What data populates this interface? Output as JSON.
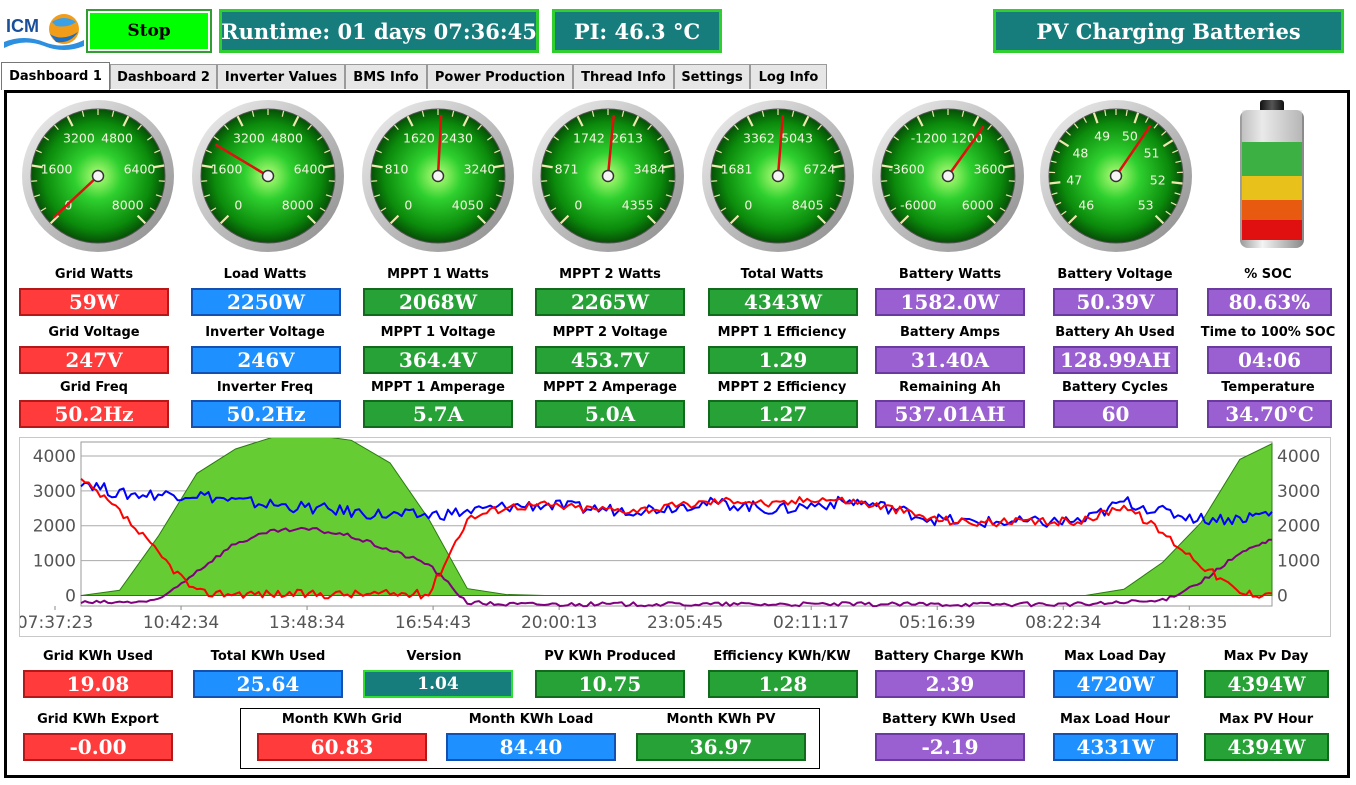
{
  "header": {
    "logo_text": "ICM",
    "stop_label": "Stop",
    "runtime": "Runtime: 01 days 07:36:45",
    "pi_temp": "PI: 46.3 °C",
    "status": "PV Charging Batteries"
  },
  "tabs": [
    {
      "label": "Dashboard 1",
      "active": true
    },
    {
      "label": "Dashboard 2"
    },
    {
      "label": "Inverter Values"
    },
    {
      "label": "BMS Info"
    },
    {
      "label": "Power Production"
    },
    {
      "label": "Thread Info"
    },
    {
      "label": "Settings"
    },
    {
      "label": "Log Info"
    }
  ],
  "gauges": [
    {
      "ticks": [
        "0",
        "1600",
        "3200",
        "4800",
        "6400",
        "8000"
      ],
      "needle_fraction": 0.007
    },
    {
      "ticks": [
        "0",
        "1600",
        "3200",
        "4800",
        "6400",
        "8000"
      ],
      "needle_fraction": 0.281
    },
    {
      "ticks": [
        "0",
        "810",
        "1620",
        "2430",
        "3240",
        "4050"
      ],
      "needle_fraction": 0.511
    },
    {
      "ticks": [
        "0",
        "871",
        "1742",
        "2613",
        "3484",
        "4355"
      ],
      "needle_fraction": 0.52
    },
    {
      "ticks": [
        "0",
        "1681",
        "3362",
        "5043",
        "6724",
        "8405"
      ],
      "needle_fraction": 0.517
    },
    {
      "ticks": [
        "-6000",
        "-3600",
        "-1200",
        "1200",
        "3600",
        "6000"
      ],
      "needle_fraction": 0.632
    },
    {
      "ticks": [
        "46",
        "47",
        "48",
        "49",
        "50",
        "51",
        "52",
        "53"
      ],
      "needle_fraction": 0.627
    }
  ],
  "battery_gauge": {
    "soc_percent": 80.63
  },
  "metrics": {
    "row1": [
      {
        "label": "Grid Watts",
        "value": "59W",
        "color": "red"
      },
      {
        "label": "Load Watts",
        "value": "2250W",
        "color": "blue"
      },
      {
        "label": "MPPT 1 Watts",
        "value": "2068W",
        "color": "green"
      },
      {
        "label": "MPPT 2 Watts",
        "value": "2265W",
        "color": "green"
      },
      {
        "label": "Total Watts",
        "value": "4343W",
        "color": "green"
      },
      {
        "label": "Battery Watts",
        "value": "1582.0W",
        "color": "purple"
      },
      {
        "label": "Battery Voltage",
        "value": "50.39V",
        "color": "purple"
      },
      {
        "label": "% SOC",
        "value": "80.63%",
        "color": "purple"
      }
    ],
    "row2": [
      {
        "label": "Grid Voltage",
        "value": "247V",
        "color": "red"
      },
      {
        "label": "Inverter Voltage",
        "value": "246V",
        "color": "blue"
      },
      {
        "label": "MPPT 1 Voltage",
        "value": "364.4V",
        "color": "green"
      },
      {
        "label": "MPPT 2 Voltage",
        "value": "453.7V",
        "color": "green"
      },
      {
        "label": "MPPT 1 Efficiency",
        "value": "1.29",
        "color": "green"
      },
      {
        "label": "Battery Amps",
        "value": "31.40A",
        "color": "purple"
      },
      {
        "label": "Battery Ah Used",
        "value": "128.99AH",
        "color": "purple"
      },
      {
        "label": "Time to 100% SOC",
        "value": "04:06",
        "color": "purple"
      }
    ],
    "row3": [
      {
        "label": "Grid Freq",
        "value": "50.2Hz",
        "color": "red"
      },
      {
        "label": "Inverter Freq",
        "value": "50.2Hz",
        "color": "blue"
      },
      {
        "label": "MPPT 1 Amperage",
        "value": "5.7A",
        "color": "green"
      },
      {
        "label": "MPPT 2 Amperage",
        "value": "5.0A",
        "color": "green"
      },
      {
        "label": "MPPT 2 Efficiency",
        "value": "1.27",
        "color": "green"
      },
      {
        "label": "Remaining Ah",
        "value": "537.01AH",
        "color": "purple"
      },
      {
        "label": "Battery Cycles",
        "value": "60",
        "color": "purple"
      },
      {
        "label": "Temperature",
        "value": "34.70°C",
        "color": "purple"
      }
    ]
  },
  "bottom": {
    "row1": [
      {
        "label": "Grid KWh Used",
        "value": "19.08",
        "color": "red"
      },
      {
        "label": "Total KWh Used",
        "value": "25.64",
        "color": "blue"
      },
      {
        "label": "Version",
        "value": "1.04",
        "color": "teal"
      },
      {
        "label": "PV KWh Produced",
        "value": "10.75",
        "color": "green"
      },
      {
        "label": "Efficiency KWh/KW",
        "value": "1.28",
        "color": "green"
      },
      {
        "label": "Battery Charge KWh",
        "value": "2.39",
        "color": "purple"
      },
      {
        "label": "Max Load Day",
        "value": "4720W",
        "color": "blue"
      },
      {
        "label": "Max Pv Day",
        "value": "4394W",
        "color": "green"
      }
    ],
    "row2": [
      {
        "label": "Grid KWh Export",
        "value": "-0.00",
        "color": "red"
      },
      {
        "label": "Month KWh Grid",
        "value": "60.83",
        "color": "red"
      },
      {
        "label": "Month KWh Load",
        "value": "84.40",
        "color": "blue"
      },
      {
        "label": "Month KWh PV",
        "value": "36.97",
        "color": "green"
      },
      {
        "label": "Battery KWh Used",
        "value": "-2.19",
        "color": "purple"
      },
      {
        "label": "Max Load Hour",
        "value": "4331W",
        "color": "blue"
      },
      {
        "label": "Max PV Hour",
        "value": "4394W",
        "color": "green"
      }
    ]
  },
  "colors": {
    "red": "#ff3b3b",
    "blue": "#1e90ff",
    "green": "#27a236",
    "purple": "#9a5fd0",
    "teal": "#167c7c",
    "pv_area": "#66cc33",
    "line_red": "#ff0000",
    "line_blue": "#0000ff",
    "line_purple": "#800080"
  },
  "chart_data": {
    "type": "line",
    "yticks": [
      "0",
      "1000",
      "2000",
      "3000",
      "4000"
    ],
    "ylim": [
      -300,
      4400
    ],
    "xticks": [
      "07:37:23",
      "10:42:34",
      "13:48:34",
      "16:54:43",
      "20:00:13",
      "23:05:45",
      "02:11:17",
      "05:16:39",
      "08:22:34",
      "11:28:35"
    ],
    "x": [
      0,
      0.3,
      0.6,
      0.9,
      1.2,
      1.5,
      1.8,
      2.1,
      2.4,
      2.7,
      3.0,
      3.3,
      3.6,
      3.9,
      4.2,
      4.5,
      4.8,
      5.1,
      5.4,
      5.7,
      6.0,
      6.3,
      6.6,
      6.9,
      7.2,
      7.5,
      7.8,
      8.1,
      8.4,
      8.7,
      9.0,
      9.25
    ],
    "series": [
      {
        "name": "pv",
        "color": "#66cc33",
        "values": [
          0,
          150,
          1700,
          3500,
          4200,
          4550,
          4600,
          4450,
          3800,
          2200,
          200,
          30,
          0,
          0,
          0,
          0,
          0,
          0,
          0,
          0,
          0,
          0,
          0,
          0,
          0,
          0,
          0,
          180,
          950,
          2100,
          3900,
          4350
        ]
      },
      {
        "name": "load",
        "color": "#0000ff",
        "values": [
          3300,
          2900,
          2900,
          2900,
          2700,
          2600,
          2500,
          2400,
          2300,
          2300,
          2400,
          2550,
          2600,
          2500,
          2450,
          2500,
          2650,
          2600,
          2450,
          2600,
          2700,
          2500,
          2200,
          2100,
          2100,
          2100,
          2150,
          2700,
          2400,
          2200,
          2200,
          2400
        ]
      },
      {
        "name": "grid",
        "color": "#ff0000",
        "values": [
          3300,
          2400,
          1200,
          80,
          60,
          50,
          40,
          40,
          50,
          40,
          2200,
          2550,
          2600,
          2500,
          2450,
          2500,
          2650,
          2750,
          2600,
          2800,
          2700,
          2500,
          2200,
          2100,
          2100,
          2100,
          2150,
          2600,
          1800,
          900,
          60,
          60
        ]
      },
      {
        "name": "battery",
        "color": "#800080",
        "values": [
          -200,
          -200,
          -150,
          700,
          1500,
          1850,
          1900,
          1700,
          1300,
          900,
          -200,
          -250,
          -250,
          -250,
          -250,
          -250,
          -250,
          -250,
          -250,
          -250,
          -250,
          -250,
          -250,
          -250,
          -250,
          -250,
          -250,
          -200,
          -150,
          400,
          1200,
          1600
        ]
      }
    ]
  }
}
